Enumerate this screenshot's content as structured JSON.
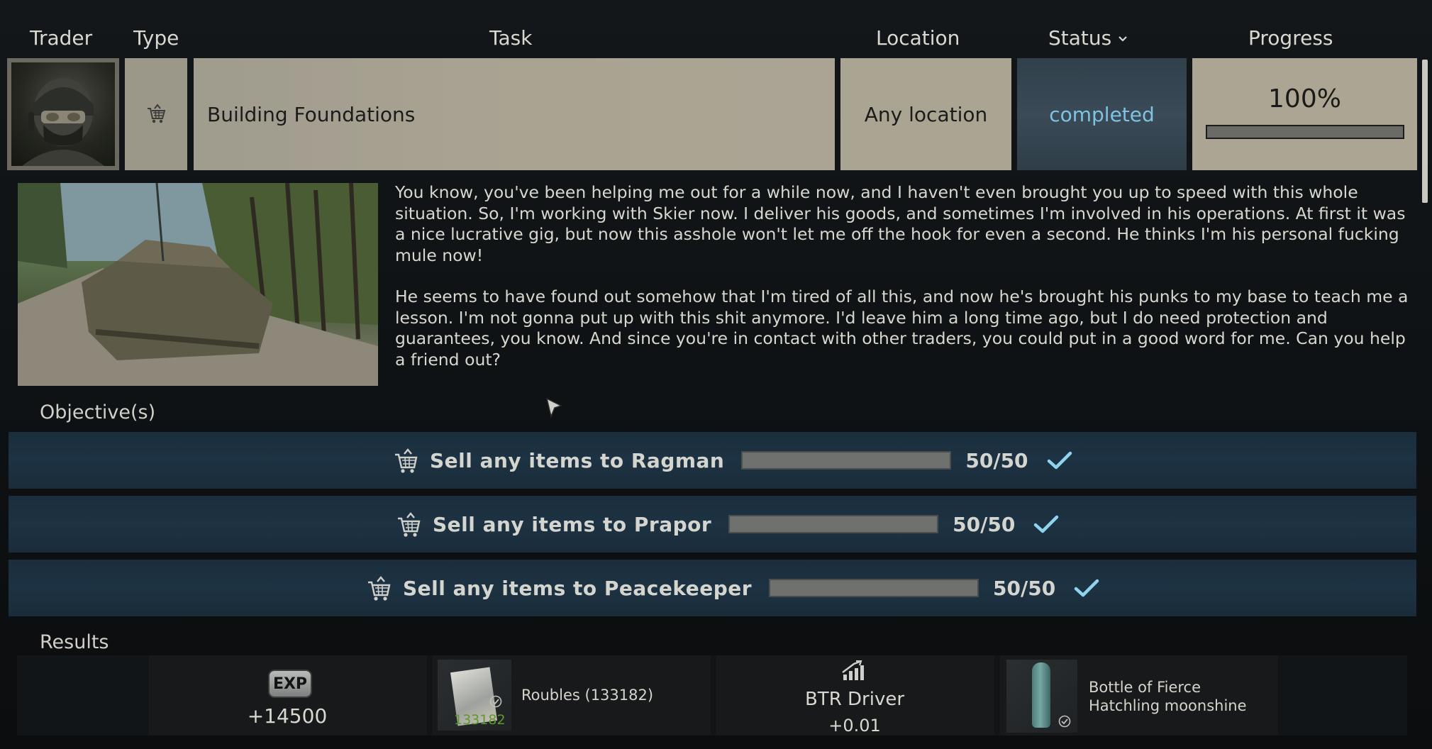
{
  "columns": {
    "trader": "Trader",
    "type": "Type",
    "task": "Task",
    "location": "Location",
    "status": "Status",
    "progress": "Progress"
  },
  "task": {
    "name": "Building Foundations",
    "location": "Any location",
    "status": "completed",
    "progress_text": "100%",
    "progress_fraction": 1.0
  },
  "description": {
    "paragraph_1": "You know, you've been helping me out for a while now, and I haven't even brought you up to speed with this whole situation. So, I'm working with Skier now. I deliver his goods, and sometimes I'm involved in his operations. At first it was a nice lucrative gig, but now this asshole won't let me off the hook for even a second. He thinks I'm his personal fucking mule now!",
    "paragraph_2": "He seems to have found out somehow that I'm tired of all this, and now he's brought his punks to my base to teach me a lesson. I'm not gonna put up with this shit anymore. I'd leave him a long time ago, but I do need protection and guarantees, you know. And since you're in contact with other traders, you could put in a good word for me. Can you help a friend out?"
  },
  "objectives": {
    "title": "Objective(s)",
    "items": [
      {
        "label": "Sell any items to Ragman",
        "count": "50/50",
        "fraction": 1.0
      },
      {
        "label": "Sell any items to Prapor",
        "count": "50/50",
        "fraction": 1.0
      },
      {
        "label": "Sell any items to Peacekeeper",
        "count": "50/50",
        "fraction": 1.0
      }
    ]
  },
  "results": {
    "title": "Results",
    "exp_badge": "EXP",
    "exp_value": "+14500",
    "roubles_count": "133182",
    "roubles_label": "Roubles (133182)",
    "btr_label": "BTR Driver",
    "btr_value": "+0.01",
    "bottle_label": "Bottle of Fierce Hatchling moonshine"
  },
  "icons": {
    "type": "shopping-cart-icon",
    "objective": "shopping-cart-icon",
    "check": "checkmark-icon",
    "btr": "rising-chart-icon"
  },
  "colors": {
    "status_text": "#7fc2e2",
    "check": "#8fd3ee",
    "roubles_count": "#5e9a2b"
  }
}
